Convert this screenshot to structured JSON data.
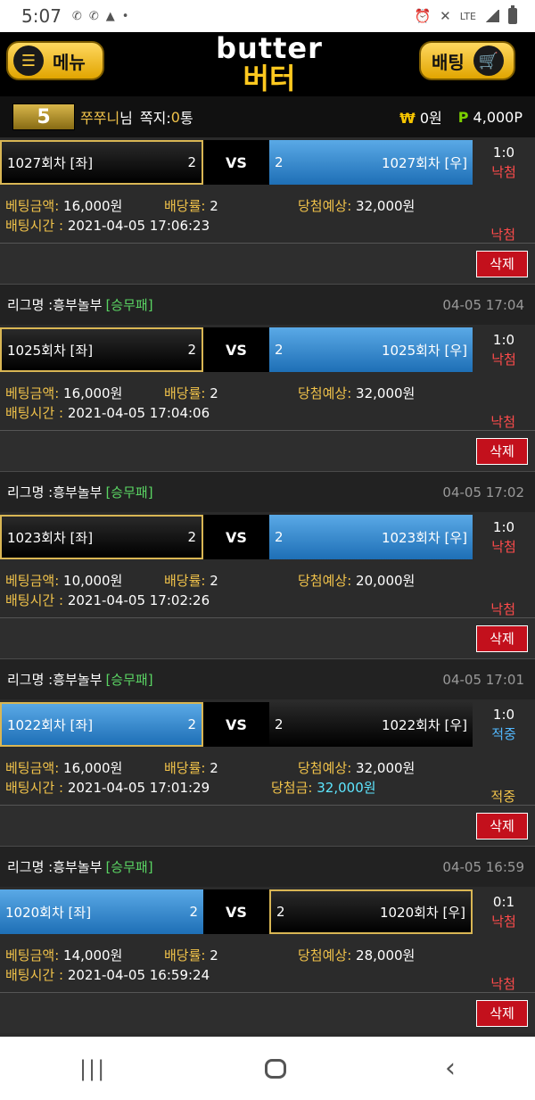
{
  "status": {
    "time": "5:07",
    "net": "LTE"
  },
  "header": {
    "menu_label": "메뉴",
    "bet_label": "배팅",
    "logo_en": "butter",
    "logo_ko": "버터"
  },
  "user": {
    "level": "5",
    "nickname": "쭈쭈니",
    "suffix": "님",
    "memo_label": "쪽지:",
    "memo_count": "0",
    "memo_unit": "통",
    "cash": "0원",
    "points": "4,000P"
  },
  "labels": {
    "bet_amount": "베팅금액:",
    "odds": "배당률:",
    "expected": "당첨예상:",
    "bet_time": "배팅시간 :",
    "win_amount": "당첨금:",
    "vs": "VS",
    "delete": "삭제",
    "league_prefix": "리그명 : ",
    "tag": "[승무패]"
  },
  "cards": [
    {
      "league": "",
      "date": "",
      "left": {
        "name": "1027회차 [좌]",
        "odd": "2",
        "style": "dark gold"
      },
      "right": {
        "name": "1027회차 [우]",
        "odd": "2",
        "style": "blue"
      },
      "score": "1:0",
      "result": "낙첨",
      "win": false,
      "amount": "16,000원",
      "odds": "2",
      "expected": "32,000원",
      "time": "2021-04-05 17:06:23",
      "status": "낙첨"
    },
    {
      "league": "흥부놀부",
      "date": "04-05 17:04",
      "left": {
        "name": "1025회차 [좌]",
        "odd": "2",
        "style": "dark gold"
      },
      "right": {
        "name": "1025회차 [우]",
        "odd": "2",
        "style": "blue"
      },
      "score": "1:0",
      "result": "낙첨",
      "win": false,
      "amount": "16,000원",
      "odds": "2",
      "expected": "32,000원",
      "time": "2021-04-05 17:04:06",
      "status": "낙첨"
    },
    {
      "league": "흥부놀부",
      "date": "04-05 17:02",
      "left": {
        "name": "1023회차 [좌]",
        "odd": "2",
        "style": "dark gold"
      },
      "right": {
        "name": "1023회차 [우]",
        "odd": "2",
        "style": "blue"
      },
      "score": "1:0",
      "result": "낙첨",
      "win": false,
      "amount": "10,000원",
      "odds": "2",
      "expected": "20,000원",
      "time": "2021-04-05 17:02:26",
      "status": "낙첨"
    },
    {
      "league": "흥부놀부",
      "date": "04-05 17:01",
      "left": {
        "name": "1022회차 [좌]",
        "odd": "2",
        "style": "blue gold"
      },
      "right": {
        "name": "1022회차 [우]",
        "odd": "2",
        "style": "dark"
      },
      "score": "1:0",
      "result": "적중",
      "win": true,
      "amount": "16,000원",
      "odds": "2",
      "expected": "32,000원",
      "time": "2021-04-05 17:01:29",
      "win_amount": "32,000원",
      "status": "적중"
    },
    {
      "league": "흥부놀부",
      "date": "04-05 16:59",
      "left": {
        "name": "1020회차 [좌]",
        "odd": "2",
        "style": "blue"
      },
      "right": {
        "name": "1020회차 [우]",
        "odd": "2",
        "style": "dark gold"
      },
      "score": "0:1",
      "result": "낙첨",
      "win": false,
      "amount": "14,000원",
      "odds": "2",
      "expected": "28,000원",
      "time": "2021-04-05 16:59:24",
      "status": "낙첨"
    }
  ]
}
